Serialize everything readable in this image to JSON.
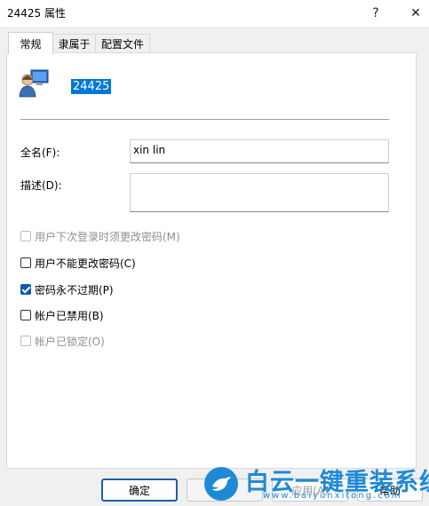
{
  "window": {
    "title": "24425 属性"
  },
  "titlebar": {
    "help_glyph": "?",
    "close_glyph": "✕"
  },
  "tabs": [
    {
      "label": "常规",
      "active": true
    },
    {
      "label": "隶属于",
      "active": false
    },
    {
      "label": "配置文件",
      "active": false
    }
  ],
  "general": {
    "username": "24425",
    "fullname_label": "全名(F):",
    "fullname_value": "xin lin",
    "description_label": "描述(D):",
    "description_value": ""
  },
  "checkboxes": [
    {
      "label": "用户下次登录时须更改密码(M)",
      "checked": false,
      "enabled": false
    },
    {
      "label": "用户不能更改密码(C)",
      "checked": false,
      "enabled": true
    },
    {
      "label": "密码永不过期(P)",
      "checked": true,
      "enabled": true
    },
    {
      "label": "帐户已禁用(B)",
      "checked": false,
      "enabled": true
    },
    {
      "label": "帐户已锁定(O)",
      "checked": false,
      "enabled": false
    }
  ],
  "buttons": {
    "ok": "确定",
    "apply": "应用(A)",
    "help": "帮助"
  },
  "watermark": {
    "text": "白云一键重装系统",
    "url": "www.baiyunxitong.com",
    "color": "#1e8ad6"
  }
}
